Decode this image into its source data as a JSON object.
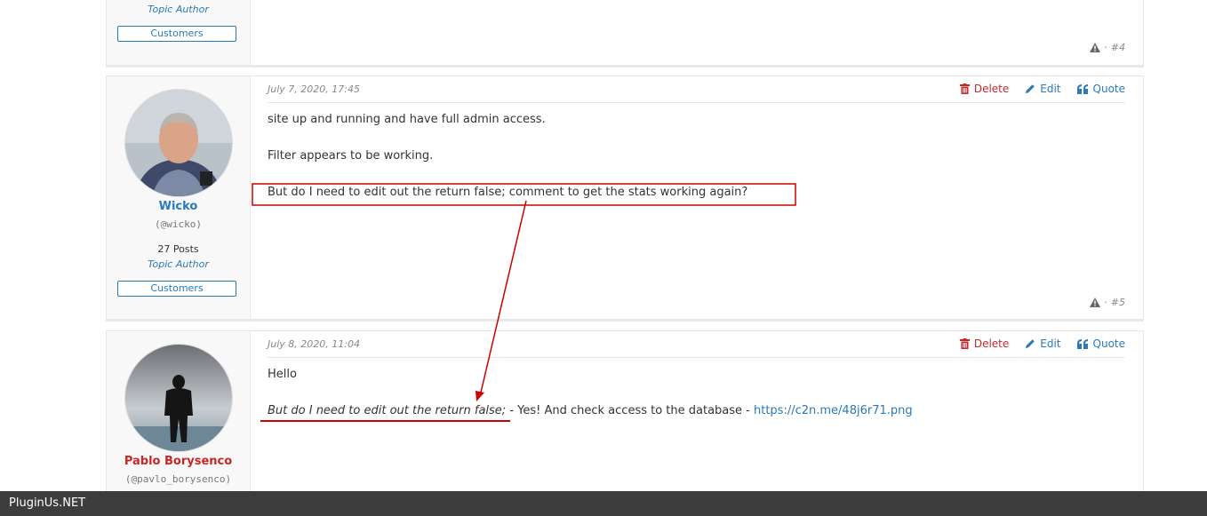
{
  "post4": {
    "author_role": "Topic Author",
    "badge": "Customers",
    "post_number": "#4"
  },
  "post5": {
    "date": "July 7, 2020, 17:45",
    "author_name": "Wicko",
    "author_handle": "(@wicko)",
    "posts_count": "27 Posts",
    "author_role": "Topic Author",
    "badge": "Customers",
    "actions": {
      "delete": "Delete",
      "edit": "Edit",
      "quote": "Quote"
    },
    "paragraphs": [
      "site up and running and have full admin access.",
      "Filter appears to be working.",
      "But do I need to edit out the return false; comment to get the stats working again?"
    ],
    "post_number": "#5"
  },
  "post6": {
    "date": "July 8, 2020, 11:04",
    "author_name": "Pablo Borysenco",
    "author_handle": "(@pavlo_borysenco)",
    "actions": {
      "delete": "Delete",
      "edit": "Edit",
      "quote": "Quote"
    },
    "greeting": "Hello",
    "quote_text": "But do I need to edit out the return false;",
    "reply_text": " - Yes!  And check access to the database - ",
    "link": "https://c2n.me/48j6r71.png"
  },
  "footer": {
    "brand": "PluginUs.NET"
  },
  "colors": {
    "accent_blue": "#2a7ab8",
    "delete_red": "#c62828",
    "annotation_red": "#cc0000",
    "footer_bg": "#3d3d3d"
  },
  "icons": {
    "delete": "trash-icon",
    "edit": "pencil-icon",
    "quote": "quote-icon",
    "report": "warning-icon"
  }
}
